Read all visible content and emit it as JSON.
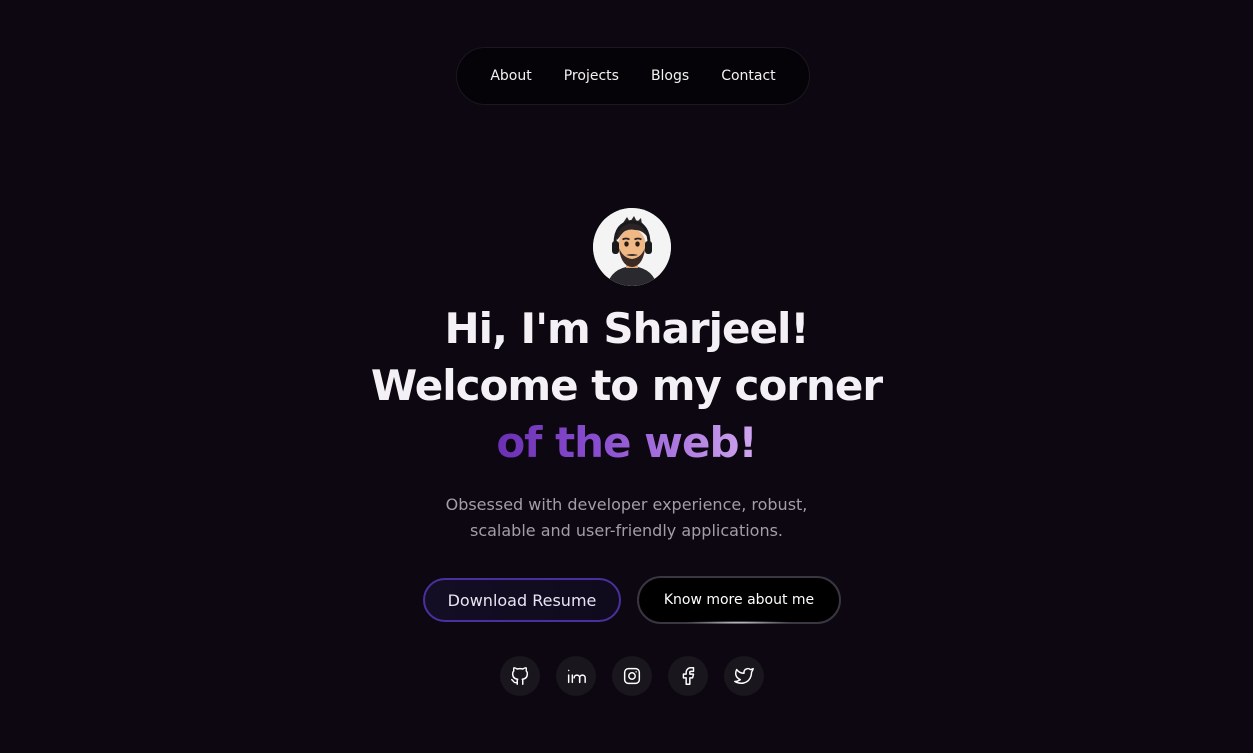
{
  "nav": {
    "items": [
      {
        "label": "About"
      },
      {
        "label": "Projects"
      },
      {
        "label": "Blogs"
      },
      {
        "label": "Contact"
      }
    ]
  },
  "hero": {
    "avatar_icon": "avatar-icon",
    "line1": "Hi, I'm Sharjeel!",
    "line2": "Welcome to my corner",
    "line3": "of the web!",
    "subtitle_line1": "Obsessed with developer experience, robust,",
    "subtitle_line2": "scalable and user-friendly applications."
  },
  "buttons": {
    "resume_label": "Download Resume",
    "about_label": "Know more about me"
  },
  "socials": [
    {
      "icon": "github-icon"
    },
    {
      "icon": "linkedin-icon"
    },
    {
      "icon": "instagram-icon"
    },
    {
      "icon": "facebook-icon"
    },
    {
      "icon": "twitter-icon"
    }
  ],
  "colors": {
    "background": "#0c0710",
    "accent_start": "#6b2fb3",
    "accent_end": "#d0a6ef",
    "resume_border": "#4a2f9e"
  }
}
